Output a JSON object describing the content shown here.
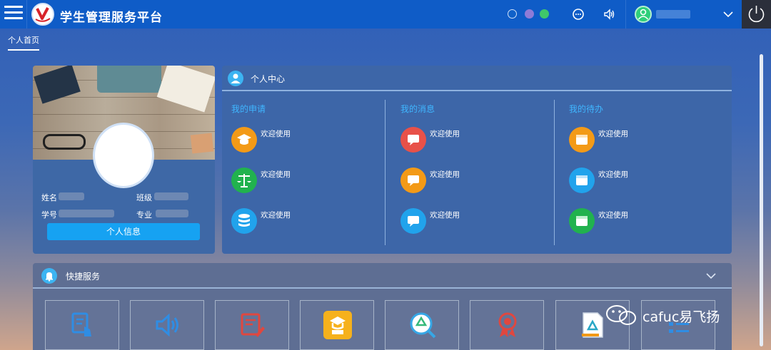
{
  "app": {
    "title": "学生管理服务平台"
  },
  "tabs": [
    {
      "label": "个人首页",
      "active": true
    }
  ],
  "theme": {
    "topbar": "#0f5cc7",
    "accent": "#16a2f2",
    "dots": [
      "#1061c9",
      "#8e7bd7",
      "#3fc86a"
    ]
  },
  "profile": {
    "name_label": "姓名",
    "class_label": "班级",
    "id_label": "学号",
    "major_label": "专业",
    "button_label": "个人信息"
  },
  "personal_center": {
    "title": "个人中心",
    "columns": [
      {
        "title": "我的申请",
        "items": [
          {
            "label": "欢迎使用",
            "icon": "graduation-cap-icon",
            "color": "#f39a17"
          },
          {
            "label": "欢迎使用",
            "icon": "scales-icon",
            "color": "#21b24e"
          },
          {
            "label": "欢迎使用",
            "icon": "database-icon",
            "color": "#21a3ec"
          }
        ]
      },
      {
        "title": "我的消息",
        "items": [
          {
            "label": "欢迎使用",
            "icon": "chat-bubble-icon",
            "color": "#e85149"
          },
          {
            "label": "欢迎使用",
            "icon": "chat-bubble-icon",
            "color": "#f39a17"
          },
          {
            "label": "欢迎使用",
            "icon": "chat-bubble-icon",
            "color": "#21a3ec"
          }
        ]
      },
      {
        "title": "我的待办",
        "items": [
          {
            "label": "欢迎使用",
            "icon": "calendar-icon",
            "color": "#f39a17"
          },
          {
            "label": "欢迎使用",
            "icon": "calendar-icon",
            "color": "#21a3ec"
          },
          {
            "label": "欢迎使用",
            "icon": "calendar-icon",
            "color": "#21b24e"
          }
        ]
      }
    ]
  },
  "quick_services": {
    "title": "快捷服务",
    "tiles": [
      {
        "icon": "document-hand-icon"
      },
      {
        "icon": "speaker-icon"
      },
      {
        "icon": "form-pen-icon"
      },
      {
        "icon": "scholar-icon"
      },
      {
        "icon": "recycle-search-icon"
      },
      {
        "icon": "award-ribbon-icon"
      },
      {
        "icon": "recycle-document-icon"
      },
      {
        "icon": "list-icon"
      }
    ]
  },
  "watermark": {
    "text": "cafuc易飞扬"
  }
}
